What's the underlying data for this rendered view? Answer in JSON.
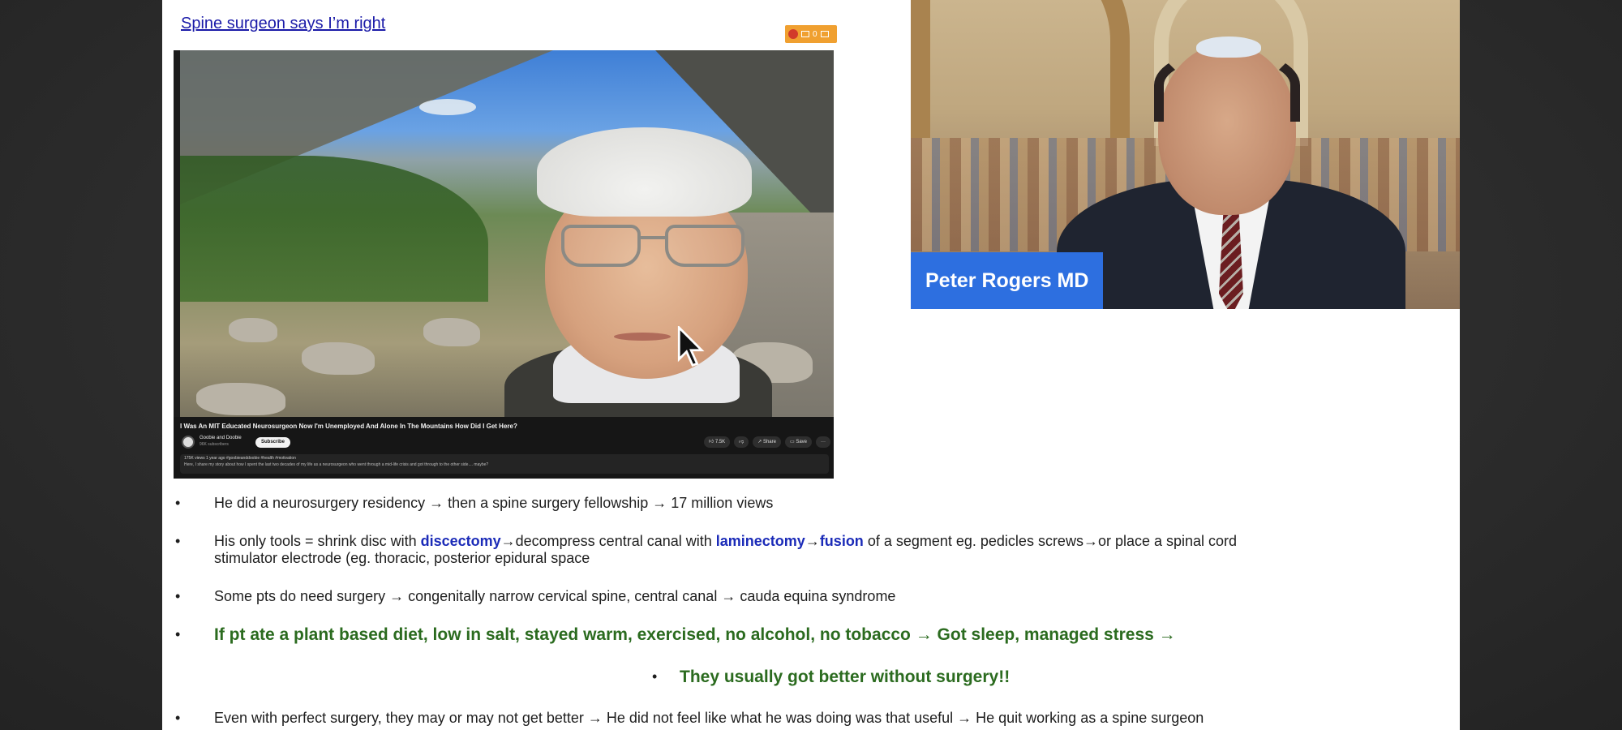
{
  "slide": {
    "title_link": "Spine surgeon says I’m right"
  },
  "badge": {
    "count": "0"
  },
  "video": {
    "title": "I Was An MIT Educated Neurosurgeon Now I'm Unemployed And Alone In The Mountains How Did I Get Here?",
    "channel_name": "Goobie and Doobie",
    "channel_subs": "96K subscribers",
    "subscribe_label": "Subscribe",
    "like_count": "7.5K",
    "share_label": "Share",
    "save_label": "Save",
    "more_label": "···",
    "desc_meta": "175K views  1 year ago  #goobieanddoobie #health #motivation",
    "desc_text": "Here, I share my story about how I spent the last two decades of my life as a neurosurgeon who went through a mid-life crisis and got through to the other side.... maybe?"
  },
  "webcam": {
    "speaker_name": "Peter Rogers MD"
  },
  "bullets": {
    "b1": "He did a neurosurgery residency → then a spine surgery fellowship → 17 million views",
    "b2_pre": "His only tools = shrink disc with ",
    "b2_kw1": "discectomy",
    "b2_mid1": "→decompress central canal with ",
    "b2_kw2": "laminectomy",
    "b2_arrow": "→",
    "b2_kw3": "fusion",
    "b2_post": " of a segment eg. pedicles screws→or place a spinal cord stimulator electrode (eg. thoracic, posterior epidural space",
    "b3": "Some pts do need surgery → congenitally narrow cervical spine, central canal → cauda equina syndrome",
    "b4": "If pt ate a plant based diet, low in salt, stayed warm, exercised, no alcohol, no tobacco → Got sleep, managed stress →",
    "b5": "They usually got better without surgery!!",
    "b6": "Even with perfect surgery, they may or may not get better → He did not feel like what he was doing was that useful → He quit working as a spine surgeon"
  },
  "bullet_symbol": "•",
  "colors": {
    "keyword_blue": "#1b2bb8",
    "emphasis_green": "#2b6b1f",
    "name_tag_blue": "#2d6fe0"
  }
}
